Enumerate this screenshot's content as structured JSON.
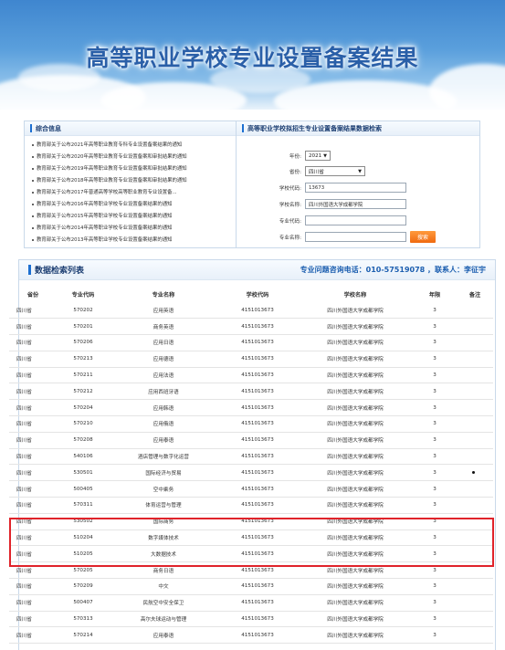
{
  "banner": {
    "title": "高等职业学校专业设置备案结果"
  },
  "news": {
    "title": "综合信息",
    "items": [
      "教育部关于公布2021年高等职业教育专科专业设置备案结果的通知",
      "教育部关于公布2020年高等职业教育专业设置备案和审批结果的通知",
      "教育部关于公布2019年高等职业教育专业设置备案和审批结果的通知",
      "教育部关于公布2018年高等职业教育专业设置备案和审批结果的通知",
      "教育部关于公布2017年普通高等学校高等职业教育专业设置备...",
      "教育部关于公布2016年高等职业学校专业设置备案结果的通知",
      "教育部关于公布2015年高等职业学校专业设置备案结果的通知",
      "教育部关于公布2014年高等职业学校专业设置备案结果的通知",
      "教育部关于公布2013年高等职业学校专业设置备案结果的通知"
    ]
  },
  "search": {
    "title": "高等职业学校拟招生专业设置备案结果数据检索",
    "year_label": "年份:",
    "year_value": "2021",
    "province_label": "省份:",
    "province_value": "四川省",
    "school_code_label": "学校代码:",
    "school_code_value": "13673",
    "school_name_label": "学校名称:",
    "school_name_value": "四川外国语大学成都学院",
    "major_code_label": "专业代码:",
    "major_code_value": "",
    "major_name_label": "专业名称:",
    "major_name_value": "",
    "button_label": "搜索"
  },
  "results": {
    "title": "数据检索列表",
    "contact": "专业问题咨询电话：010-57519078 ，联系人：李征宇",
    "headers": [
      "省份",
      "专业代码",
      "专业名称",
      "学校代码",
      "学校名称",
      "年限",
      "备注"
    ],
    "rows": [
      [
        "四川省",
        "570202",
        "应用英语",
        "4151013673",
        "四川外国语大学成都学院",
        "3",
        ""
      ],
      [
        "四川省",
        "570201",
        "商务英语",
        "4151013673",
        "四川外国语大学成都学院",
        "3",
        ""
      ],
      [
        "四川省",
        "570206",
        "应用日语",
        "4151013673",
        "四川外国语大学成都学院",
        "3",
        ""
      ],
      [
        "四川省",
        "570213",
        "应用德语",
        "4151013673",
        "四川外国语大学成都学院",
        "3",
        ""
      ],
      [
        "四川省",
        "570211",
        "应用法语",
        "4151013673",
        "四川外国语大学成都学院",
        "3",
        ""
      ],
      [
        "四川省",
        "570212",
        "应用西班牙语",
        "4151013673",
        "四川外国语大学成都学院",
        "3",
        ""
      ],
      [
        "四川省",
        "570204",
        "应用韩语",
        "4151013673",
        "四川外国语大学成都学院",
        "3",
        ""
      ],
      [
        "四川省",
        "570210",
        "应用俄语",
        "4151013673",
        "四川外国语大学成都学院",
        "3",
        ""
      ],
      [
        "四川省",
        "570208",
        "应用泰语",
        "4151013673",
        "四川外国语大学成都学院",
        "3",
        ""
      ],
      [
        "四川省",
        "540106",
        "酒店管理与数字化运营",
        "4151013673",
        "四川外国语大学成都学院",
        "3",
        ""
      ],
      [
        "四川省",
        "530501",
        "国际经济与贸易",
        "4151013673",
        "四川外国语大学成都学院",
        "3",
        ""
      ],
      [
        "四川省",
        "500405",
        "空中乘务",
        "4151013673",
        "四川外国语大学成都学院",
        "3",
        ""
      ],
      [
        "四川省",
        "570311",
        "体育运营与管理",
        "4151013673",
        "四川外国语大学成都学院",
        "3",
        ""
      ],
      [
        "四川省",
        "530502",
        "国际商务",
        "4151013673",
        "四川外国语大学成都学院",
        "3",
        ""
      ],
      [
        "四川省",
        "510204",
        "数字媒体技术",
        "4151013673",
        "四川外国语大学成都学院",
        "3",
        ""
      ],
      [
        "四川省",
        "510205",
        "大数据技术",
        "4151013673",
        "四川外国语大学成都学院",
        "3",
        ""
      ],
      [
        "四川省",
        "570205",
        "商务日语",
        "4151013673",
        "四川外国语大学成都学院",
        "3",
        ""
      ],
      [
        "四川省",
        "570209",
        "中文",
        "4151013673",
        "四川外国语大学成都学院",
        "3",
        ""
      ],
      [
        "四川省",
        "500407",
        "民航空中安全保卫",
        "4151013673",
        "四川外国语大学成都学院",
        "3",
        ""
      ],
      [
        "四川省",
        "570313",
        "高尔夫球运动与管理",
        "4151013673",
        "四川外国语大学成都学院",
        "3",
        ""
      ],
      [
        "四川省",
        "570214",
        "应用泰语",
        "4151013673",
        "四川外国语大学成都学院",
        "3",
        ""
      ]
    ]
  },
  "colors": {
    "accent": "#1c6fd1",
    "title_blue": "#1d3f73",
    "search_button": "#f07a1a",
    "highlight_border": "#e0232a"
  }
}
